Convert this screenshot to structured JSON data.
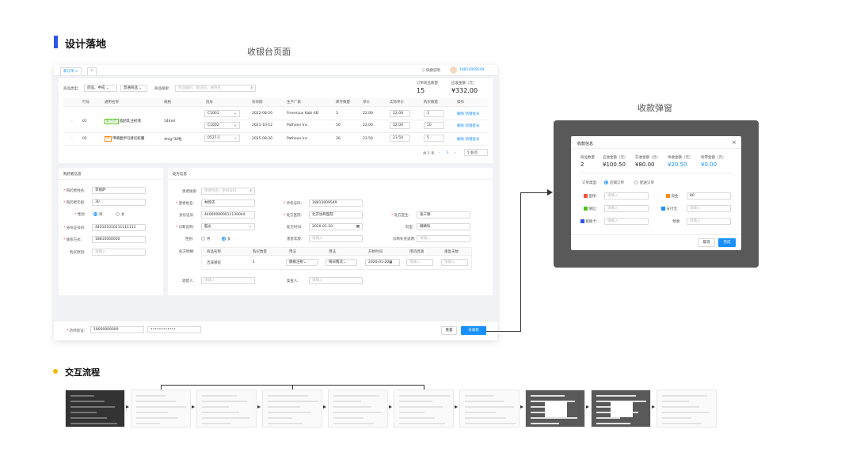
{
  "page": {
    "design_title": "设计落地",
    "cashier_caption": "收银台页面",
    "modal_caption": "收款弹窗",
    "flow_title": "交互流程"
  },
  "mock": {
    "tabs": [
      "新订单",
      "+"
    ],
    "quick_help": "快捷说明",
    "user_phone": "18813009549",
    "filter": {
      "type_label": "商品类型:",
      "type_value": "药品、中成",
      "type2_value": "普通商品",
      "search_label": "商品搜索:",
      "search_placeholder": "商品编码、助记码、通用名"
    },
    "summary": {
      "count_label": "订单商品数量",
      "count_value": "15",
      "amount_label": "应收金额（元）",
      "amount_value": "¥332.00"
    },
    "table": {
      "headers": [
        "行号",
        "通用名称",
        "规格",
        "批号",
        "有效期",
        "生产厂家",
        "库存数量",
        "单价",
        "实际单价",
        "购买数量",
        "操作"
      ],
      "rows": [
        {
          "no": "01",
          "tag": "处方药",
          "name": "脂肪乳注射液",
          "spec": "144ml",
          "lots": [
            {
              "lot": "C1001",
              "exp": "2022-08-20",
              "maker": "Fresenius Kabi AB",
              "stock": "3",
              "price": "22.00",
              "real": "22.00",
              "qty": "3",
              "op1": "删除",
              "op2": "新增批号"
            },
            {
              "lot": "C1002",
              "exp": "2021-10-12",
              "maker": "Patheon Inc.",
              "stock": "50",
              "price": "22.00",
              "real": "22.00",
              "qty": "10",
              "op1": "删除",
              "op2": "新增批号"
            }
          ]
        },
        {
          "no": "02",
          "tag": "中",
          "name": "甲磺酸伊马替尼胶囊",
          "spec": "4mg*30粒",
          "lots": [
            {
              "lot": "0527-1",
              "exp": "2025-08-20",
              "maker": "Patheon Inc.",
              "stock": "30",
              "price": "23.50",
              "real": "23.50",
              "qty": "5",
              "op1": "删除",
              "op2": "新增批号"
            }
          ]
        }
      ],
      "pagination": {
        "total": "共 2 条",
        "page": "1",
        "size": "5 条/页"
      }
    },
    "buyer": {
      "title": "购药者信息",
      "name_label": "购药者姓名:",
      "name_value": "李丽萨",
      "age_label": "购药者年龄:",
      "age_value": "30",
      "gender_label": "性别:",
      "male": "男",
      "female": "女",
      "id_label": "身份证号码:",
      "id_value": "440101010211111111",
      "contact_label": "联系方式:",
      "contact_value": "18810000000",
      "reason_label": "购买原因:",
      "reason_placeholder": "请输入"
    },
    "rx": {
      "title": "处方信息",
      "patient_search_label": "患者搜索:",
      "patient_search_placeholder": "患者姓名、手机号码",
      "patient_name_label": "患者姓名:",
      "patient_name_value": "林瑶子",
      "phone_label": "手机号码:",
      "phone_value": "18813009549",
      "id_label": "身份证号:",
      "id_value": "440000000011130044",
      "hospital_label": "处方医院:",
      "hospital_value": "北京协和医院",
      "doctor_label": "处方医生:",
      "doctor_value": "张三德",
      "diagnosis_label": "诊断说明:",
      "diagnosis_value": "脑炎",
      "time_label": "处方时间:",
      "time_value": "2020-01-20",
      "dept_label": "科室:",
      "dept_value": "眼睛科",
      "gender_label": "性别:",
      "male": "男",
      "female": "女",
      "age_label": "患者年龄:",
      "age_placeholder": "请输入",
      "extra_label": "诊断补充说明:",
      "extra_placeholder": "请输入",
      "detail_label": "处方明细:",
      "detail_headers": [
        "商品名称",
        "购买数量",
        "用法",
        "用法",
        "开始时间",
        "用药周期",
        "重复天数"
      ],
      "detail_row": [
        "吉非替尼",
        "1",
        "静脉注射",
        "每日两次",
        "2020-01-20",
        "请输入",
        "请输入"
      ],
      "dispense_label": "调配人:",
      "dispense_placeholder": "请输入",
      "review_label": "复查人:",
      "review_placeholder": "请输入"
    },
    "footer": {
      "pharmacist_label": "药师验证:",
      "pharmacist_value": "18000000000",
      "password_value": "••••••••••••",
      "reset": "重置",
      "collect": "去收款"
    }
  },
  "modal": {
    "title": "收款信息",
    "close": "×",
    "stats": [
      {
        "label": "商品数量",
        "value": "2"
      },
      {
        "label": "应收金额（元）",
        "value": "¥100.50"
      },
      {
        "label": "实收金额（元）",
        "value": "¥80.00"
      },
      {
        "label": "待收金额（元）",
        "value": "¥20.50"
      },
      {
        "label": "找零金额（元）",
        "value": "¥0.00"
      }
    ],
    "order_type_label": "订单类型:",
    "order_type_options": [
      "店铺订单",
      "配送订单"
    ],
    "pay": [
      {
        "label": "医保:",
        "value": "请输入",
        "color": "#f5533d"
      },
      {
        "label": "现金:",
        "value": "80",
        "color": "#fa8c16"
      },
      {
        "label": "微信:",
        "value": "请输入",
        "color": "#52c41a"
      },
      {
        "label": "支付宝:",
        "value": "请输入",
        "color": "#1890ff"
      },
      {
        "label": "银联卡:",
        "value": "请输入",
        "color": "#2f54eb"
      },
      {
        "label": "预收:",
        "value": "请输入",
        "color": ""
      }
    ],
    "cancel": "取消",
    "done": "完成"
  },
  "flow": {
    "thumb_count": 10
  },
  "colors": {
    "accent": "#1890ff",
    "brand_bar": "#2f54eb",
    "highlight": "#1890ff"
  }
}
